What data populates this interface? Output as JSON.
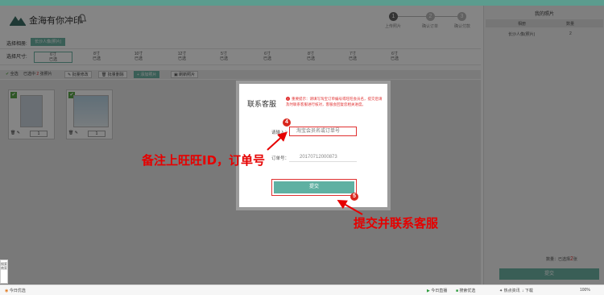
{
  "app": {
    "title": "金海有你冲印"
  },
  "steps": [
    {
      "label": "上传照片",
      "number": "1",
      "active": true
    },
    {
      "label": "确认订单",
      "number": "2",
      "active": false
    },
    {
      "label": "确认付款",
      "number": "3",
      "active": false
    }
  ],
  "album": {
    "label": "选择相册:",
    "selected": "长沙人像(照片)"
  },
  "sizes": {
    "label": "选择尺寸:",
    "items": [
      {
        "size": "6寸",
        "note": "已选"
      },
      {
        "size": "8寸",
        "note": "已选"
      },
      {
        "size": "10寸",
        "note": "已选"
      },
      {
        "size": "12寸",
        "note": "已选"
      },
      {
        "size": "5寸",
        "note": "已选"
      },
      {
        "size": "6寸",
        "note": "已选"
      },
      {
        "size": "8寸",
        "note": "已选"
      },
      {
        "size": "7寸",
        "note": "已选"
      },
      {
        "size": "6寸",
        "note": "已选"
      }
    ]
  },
  "toolbar": {
    "select_all": "全选",
    "selected_prefix": "已选中",
    "selected_count": "2",
    "selected_suffix": "张照片",
    "batch_edit": "批量修改",
    "batch_delete": "批量删除",
    "add_photos": "添加照片",
    "refresh": "刷新照片"
  },
  "thumbnails": [
    {
      "qty": "1"
    },
    {
      "qty": "1"
    }
  ],
  "right_panel": {
    "title": "我的照片",
    "col_size": "相册",
    "col_count": "数量",
    "row_name": "长沙人像(照片)",
    "row_count": "2",
    "count_label": "数量：已选择",
    "count_value": "2",
    "count_unit": "张",
    "submit": "提交"
  },
  "dialog": {
    "title": "联系客服",
    "notice": "重要提示：请填写淘宝订单编号或旺旺会员名，提交后请及时联系客服进行核对，客服会回复您相关进度。",
    "input_label": "请输入：",
    "input_placeholder": "淘宝会员名或订单号",
    "order_label": "订单号：",
    "order_value": "20170712000873",
    "submit": "提交"
  },
  "annotations": {
    "marker_4": "4",
    "marker_5": "5",
    "text_1": "备注上旺旺ID，订单号",
    "text_2": "提交并联系客服"
  },
  "left_tab": "搜索商家",
  "statusbar": {
    "news": "今日优选",
    "speed": "今日直播",
    "security": "搜索优选",
    "hotspot": "热点资讯",
    "download": "下载",
    "zoom": "100%"
  },
  "colors": {
    "accent": "#6db5a6",
    "annotation_red": "#e60000",
    "topbar": "#5b9c8e"
  }
}
